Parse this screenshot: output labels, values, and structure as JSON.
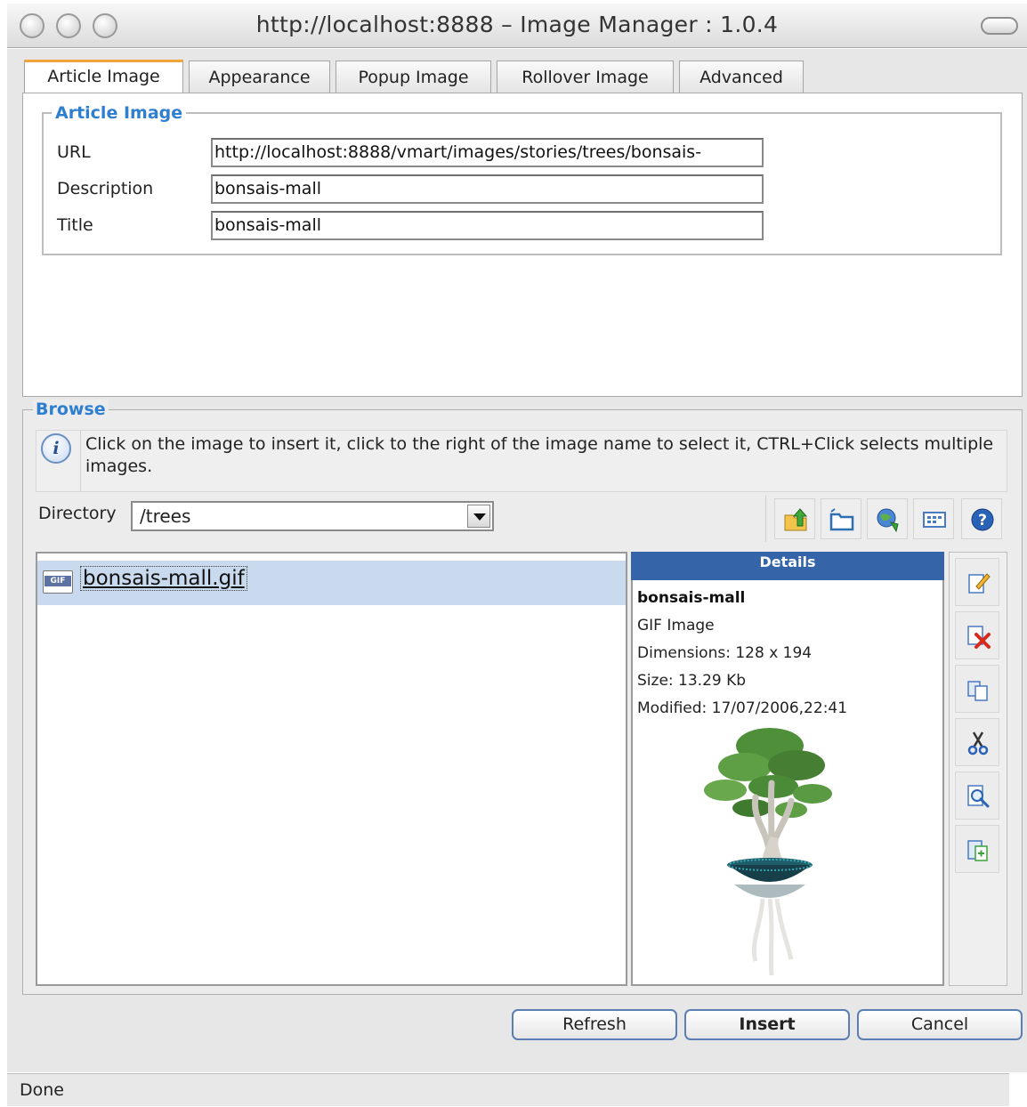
{
  "window": {
    "title": "http://localhost:8888 – Image Manager : 1.0.4"
  },
  "tabs": [
    {
      "label": "Article Image"
    },
    {
      "label": "Appearance"
    },
    {
      "label": "Popup Image"
    },
    {
      "label": "Rollover Image"
    },
    {
      "label": "Advanced"
    }
  ],
  "article_image": {
    "legend": "Article Image",
    "url_label": "URL",
    "url_value": "http://localhost:8888/vmart/images/stories/trees/bonsais-",
    "description_label": "Description",
    "description_value": "bonsais-mall",
    "title_label": "Title",
    "title_value": "bonsais-mall"
  },
  "browse": {
    "legend": "Browse",
    "info_text": "Click on the image to insert it, click to the right of the image name to select it, CTRL+Click selects multiple images.",
    "directory_label": "Directory",
    "directory_value": "/trees",
    "toolbar_icons": [
      "folder-up-icon",
      "new-folder-icon",
      "refresh-globe-icon",
      "view-mode-icon",
      "help-icon"
    ]
  },
  "file_list": {
    "items": [
      {
        "type_badge": "GIF",
        "name": "bonsais-mall.gif",
        "selected": true
      }
    ]
  },
  "details": {
    "header": "Details",
    "name": "bonsais-mall",
    "type": "GIF Image",
    "dimensions": "Dimensions: 128 x 194",
    "size": "Size: 13.29 Kb",
    "modified": "Modified: 17/07/2006,22:41"
  },
  "side_actions": [
    "edit-icon",
    "delete-icon",
    "copy-icon",
    "cut-icon",
    "preview-icon",
    "paste-icon"
  ],
  "buttons": {
    "refresh": "Refresh",
    "insert": "Insert",
    "cancel": "Cancel"
  },
  "status": {
    "text": "Done"
  },
  "colors": {
    "accent_tab": "#f0a43a",
    "legend_blue": "#2f7fd0",
    "details_header": "#3565a8",
    "selection": "#c9d9ee"
  }
}
